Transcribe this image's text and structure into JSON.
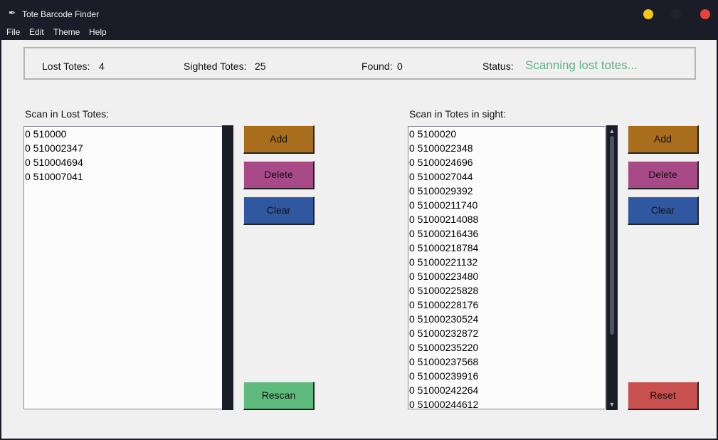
{
  "window": {
    "title": "Tote Barcode Finder",
    "app_icon": "feather-icon",
    "controls": [
      {
        "name": "minimize-button",
        "color": "#f5c518"
      },
      {
        "name": "maximize-button",
        "color": "#20232d"
      },
      {
        "name": "close-button",
        "color": "#e8443a"
      }
    ]
  },
  "menu": {
    "items": [
      "File",
      "Edit",
      "Theme",
      "Help"
    ]
  },
  "status_bar": {
    "lost_label": "Lost Totes:",
    "lost_value": "4",
    "sighted_label": "Sighted Totes:",
    "sighted_value": "25",
    "found_label": "Found:",
    "found_value": "0",
    "status_label": "Status:",
    "status_value": "Scanning lost totes...",
    "status_color": "#5cb585"
  },
  "lost_panel": {
    "label": "Scan in Lost Totes:",
    "items": [
      "0 510000",
      "0 510002347",
      "0 510004694",
      "0 510007041"
    ],
    "buttons": {
      "add": "Add",
      "delete": "Delete",
      "clear": "Clear",
      "rescan": "Rescan"
    }
  },
  "sighted_panel": {
    "label": "Scan in Totes in sight:",
    "items": [
      "0 5100020",
      "0 5100022348",
      "0 5100024696",
      "0 5100027044",
      "0 5100029392",
      "0 51000211740",
      "0 51000214088",
      "0 51000216436",
      "0 51000218784",
      "0 51000221132",
      "0 51000223480",
      "0 51000225828",
      "0 51000228176",
      "0 51000230524",
      "0 51000232872",
      "0 51000235220",
      "0 51000237568",
      "0 51000239916",
      "0 51000242264",
      "0 51000244612"
    ],
    "buttons": {
      "add": "Add",
      "delete": "Delete",
      "clear": "Clear",
      "reset": "Reset"
    }
  },
  "colors": {
    "add": "#a86e1c",
    "delete": "#a84a88",
    "clear": "#2f58a1",
    "rescan": "#5fbb7d",
    "reset": "#c8504e",
    "background": "#f0f0f0",
    "chrome": "#1a1d27"
  }
}
